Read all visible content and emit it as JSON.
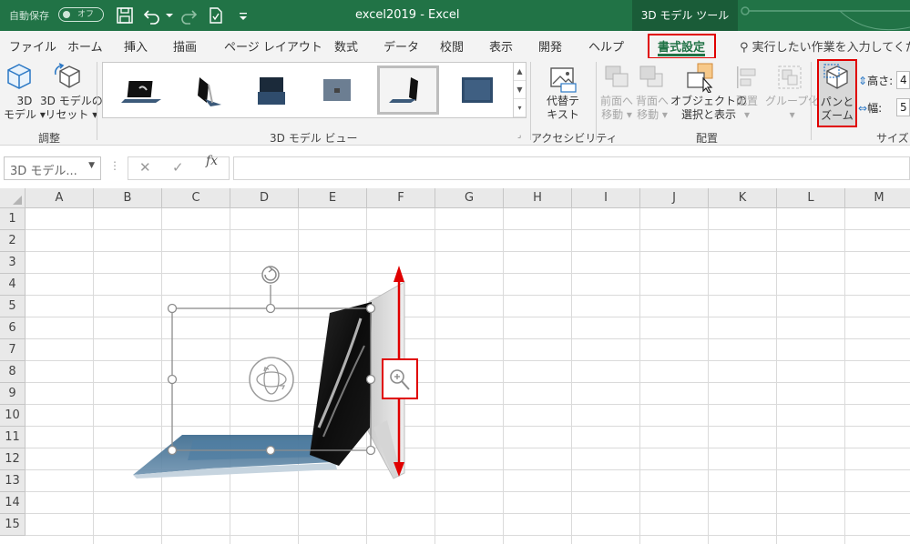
{
  "title_bar": {
    "autosave_label": "自動保存",
    "autosave_state": "オフ",
    "document_title": "excel2019  -  Excel",
    "contextual_tools": "3D モデル ツール"
  },
  "tabs": [
    {
      "label": "ファイル"
    },
    {
      "label": "ホーム"
    },
    {
      "label": "挿入"
    },
    {
      "label": "描画"
    },
    {
      "label": "ページ レイアウト"
    },
    {
      "label": "数式"
    },
    {
      "label": "データ"
    },
    {
      "label": "校閲"
    },
    {
      "label": "表示"
    },
    {
      "label": "開発"
    },
    {
      "label": "ヘルプ"
    },
    {
      "label": "書式設定",
      "active": true
    }
  ],
  "tell_me": "実行したい作業を入力してくだ",
  "ribbon": {
    "model_3d": {
      "line1": "3D",
      "line2": "モデル ▾"
    },
    "reset_model": {
      "line1": "3D モデルの",
      "line2": "リセット ▾"
    },
    "group_adjust": "調整",
    "group_views": "3D モデル ビュー",
    "alt_text": {
      "line1": "代替テ",
      "line2": "キスト"
    },
    "group_accessibility": "アクセシビリティ",
    "bring_forward": {
      "line1": "前面へ",
      "line2": "移動 ▾"
    },
    "send_backward": {
      "line1": "背面へ",
      "line2": "移動 ▾"
    },
    "selection_pane": {
      "line1": "オブジェクトの",
      "line2": "選択と表示"
    },
    "align": {
      "line1": "配置",
      "line2": "▾"
    },
    "group": {
      "line1": "グループ化",
      "line2": "▾"
    },
    "group_arrange": "配置",
    "pan_zoom": {
      "line1": "パンと",
      "line2": "ズーム"
    },
    "height_label": "高さ:",
    "height_value": "4",
    "width_label": "幅:",
    "width_value": "5",
    "group_size": "サイズ"
  },
  "formula_bar": {
    "name_box": "3D モデル...",
    "cancel": "✕",
    "enter": "✓",
    "fx": "fx",
    "formula": ""
  },
  "columns": [
    "A",
    "B",
    "C",
    "D",
    "E",
    "F",
    "G",
    "H",
    "I",
    "J",
    "K",
    "L",
    "M"
  ],
  "rows": [
    "1",
    "2",
    "3",
    "4",
    "5",
    "6",
    "7",
    "8",
    "9",
    "10",
    "11",
    "12",
    "13",
    "14",
    "15"
  ],
  "colors": {
    "excel_green": "#217346",
    "highlight_red": "#e00000",
    "handle_gray": "#8c8c8c"
  }
}
